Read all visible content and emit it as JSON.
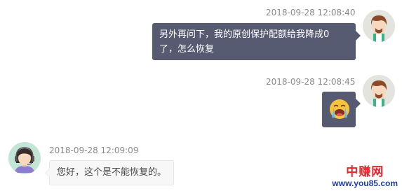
{
  "messages": [
    {
      "side": "right",
      "timestamp": "2018-09-28 12:08:40",
      "text_line1": "另外再问下，我的原创保护配额给我降成0",
      "text_line2": "了，怎么恢复"
    },
    {
      "side": "right",
      "timestamp": "2018-09-28 12:08:45",
      "icon": "crying-emoji-icon"
    },
    {
      "side": "left",
      "timestamp": "2018-09-28 12:09:09",
      "text": "您好，这个是不能恢复的。"
    }
  ],
  "watermark": {
    "title": "中赚网",
    "url": "www.you85.com"
  },
  "colors": {
    "outgoing_bubble": "#565b72",
    "incoming_bubble": "#f7f7f7",
    "timestamp": "#8a8a8a"
  }
}
